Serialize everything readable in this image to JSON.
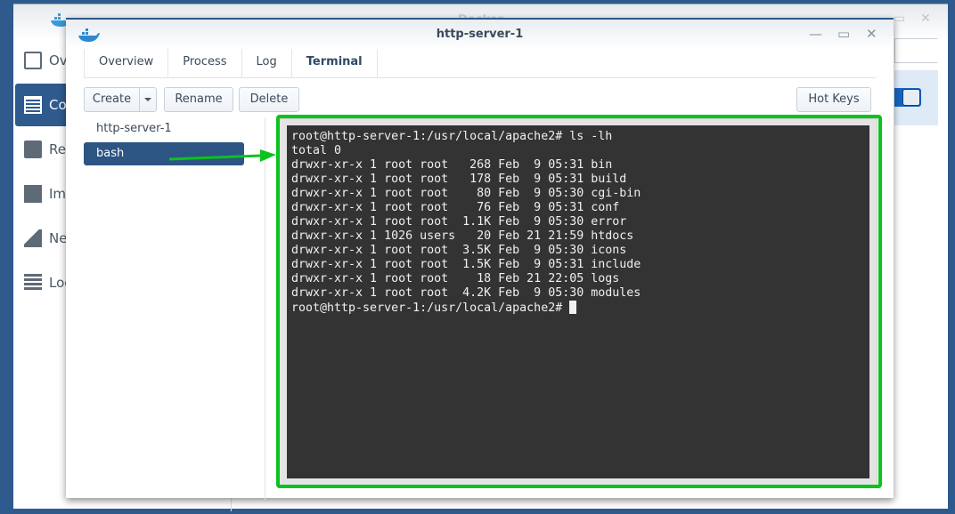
{
  "background_window": {
    "title": "Docker",
    "sidebar": [
      {
        "label": "Ov",
        "icon": "overview-icon"
      },
      {
        "label": "Co",
        "icon": "container-icon",
        "selected": true
      },
      {
        "label": "Re",
        "icon": "registry-icon"
      },
      {
        "label": "Im",
        "icon": "image-icon"
      },
      {
        "label": "Ne",
        "icon": "network-icon"
      },
      {
        "label": "Log",
        "icon": "log-icon"
      }
    ],
    "toggle_on": true
  },
  "window": {
    "title": "http-server-1",
    "tabs": [
      {
        "label": "Overview"
      },
      {
        "label": "Process"
      },
      {
        "label": "Log"
      },
      {
        "label": "Terminal",
        "active": true
      }
    ],
    "toolbar": {
      "create": "Create",
      "rename": "Rename",
      "delete": "Delete",
      "hot_keys": "Hot Keys"
    },
    "sessions": [
      {
        "label": "http-server-1"
      },
      {
        "label": "bash",
        "selected": true
      }
    ],
    "terminal": {
      "lines": [
        "root@http-server-1:/usr/local/apache2# ls -lh",
        "total 0",
        "drwxr-xr-x 1 root root   268 Feb  9 05:31 bin",
        "drwxr-xr-x 1 root root   178 Feb  9 05:31 build",
        "drwxr-xr-x 1 root root    80 Feb  9 05:30 cgi-bin",
        "drwxr-xr-x 1 root root    76 Feb  9 05:31 conf",
        "drwxr-xr-x 1 root root  1.1K Feb  9 05:30 error",
        "drwxr-xr-x 1 1026 users   20 Feb 21 21:59 htdocs",
        "drwxr-xr-x 1 root root  3.5K Feb  9 05:30 icons",
        "drwxr-xr-x 1 root root  1.5K Feb  9 05:31 include",
        "drwxr-xr-x 1 root root    18 Feb 21 22:05 logs",
        "drwxr-xr-x 1 root root  4.2K Feb  9 05:30 modules"
      ],
      "prompt": "root@http-server-1:/usr/local/apache2# "
    }
  },
  "colors": {
    "accent": "#2f5a8e",
    "highlight": "#0bc31d",
    "terminal_bg": "#333333"
  }
}
